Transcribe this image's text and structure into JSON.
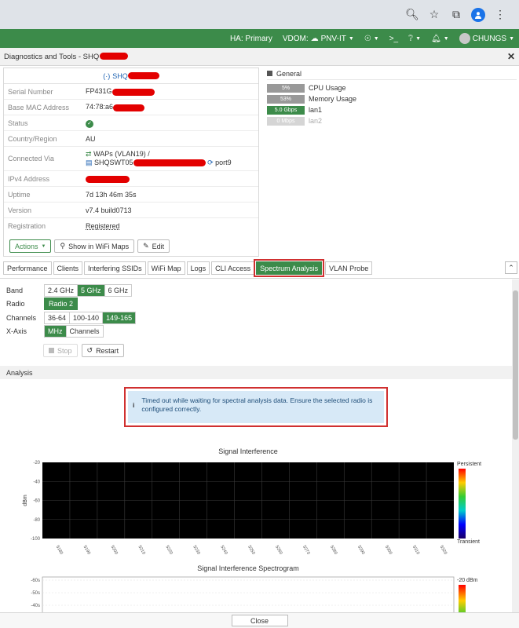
{
  "browser": {
    "icons": [
      "zoom-icon",
      "bookmark-star-icon",
      "extension-icon",
      "profile-icon",
      "more-icon"
    ]
  },
  "topbar": {
    "ha": "HA: Primary",
    "vdom_label": "VDOM:",
    "vdom_value": "PNV-IT",
    "user": "CHUNGS",
    "color": "#3c8b4a"
  },
  "dialog": {
    "title": "Diagnostics and Tools - SHQ"
  },
  "device": {
    "name": "SHQ",
    "rows": [
      {
        "label": "Serial Number",
        "value": "FP431G"
      },
      {
        "label": "Base MAC Address",
        "value": "74:78:a6"
      },
      {
        "label": "Status",
        "value": ""
      },
      {
        "label": "Country/Region",
        "value": "AU"
      },
      {
        "label": "Connected Via",
        "value": "WAPs (VLAN19) /",
        "value2": "SHQSWT05",
        "value3": "port9"
      },
      {
        "label": "IPv4 Address",
        "value": ""
      },
      {
        "label": "Uptime",
        "value": "7d 13h 46m 35s"
      },
      {
        "label": "Version",
        "value": "v7.4 build0713"
      },
      {
        "label": "Registration",
        "value": "Registered"
      }
    ],
    "buttons": {
      "actions": "Actions",
      "show_map": "Show in WiFi Maps",
      "edit": "Edit"
    }
  },
  "general": {
    "title": "General",
    "items": [
      {
        "bar": "5%",
        "label": "CPU Usage",
        "color": "#999999"
      },
      {
        "bar": "53%",
        "label": "Memory Usage",
        "color": "#999999"
      },
      {
        "bar": "5.0 Gbps",
        "label": "lan1",
        "color": "#3c8b4a"
      },
      {
        "bar": "0 Mbps",
        "label": "lan2",
        "color": "#d5d5d5"
      }
    ]
  },
  "tabs": [
    "Performance",
    "Clients",
    "Interfering SSIDs",
    "WiFi Map",
    "Logs",
    "CLI Access",
    "Spectrum Analysis",
    "VLAN Probe"
  ],
  "active_tab": "Spectrum Analysis",
  "spectrum": {
    "band_label": "Band",
    "bands": [
      "2.4 GHz",
      "5 GHz",
      "6 GHz"
    ],
    "band_selected": "5 GHz",
    "radio_label": "Radio",
    "radio_value": "Radio 2",
    "channels_label": "Channels",
    "channels": [
      "36-64",
      "100-140",
      "149-165"
    ],
    "channel_selected": "149-165",
    "xaxis_label": "X-Axis",
    "xaxis": [
      "MHz",
      "Channels"
    ],
    "xaxis_selected": "MHz",
    "stop": "Stop",
    "restart": "Restart",
    "analysis_title": "Analysis",
    "message": "Timed out while waiting for spectral analysis data. Ensure the selected radio is configured correctly."
  },
  "chart_data": [
    {
      "type": "heatmap",
      "title": "Signal Interference",
      "ylabel": "dBm",
      "ylim": [
        -100,
        -20
      ],
      "yticks": [
        -20,
        -40,
        -60,
        -80,
        -100
      ],
      "xticks": [
        "5180",
        "5190",
        "5200",
        "5210",
        "5220",
        "5230",
        "5240",
        "5250",
        "5260",
        "5270",
        "5280",
        "5290",
        "5300",
        "5310",
        "5320"
      ],
      "legend": {
        "top": "Persistent",
        "bottom": "Transient"
      },
      "values": []
    },
    {
      "type": "heatmap",
      "title": "Signal Interference Spectrogram",
      "yticks": [
        "-60s",
        "-50s",
        "-40s"
      ],
      "legend": {
        "top": "-20 dBm"
      },
      "values": []
    }
  ],
  "footer": {
    "close": "Close"
  }
}
